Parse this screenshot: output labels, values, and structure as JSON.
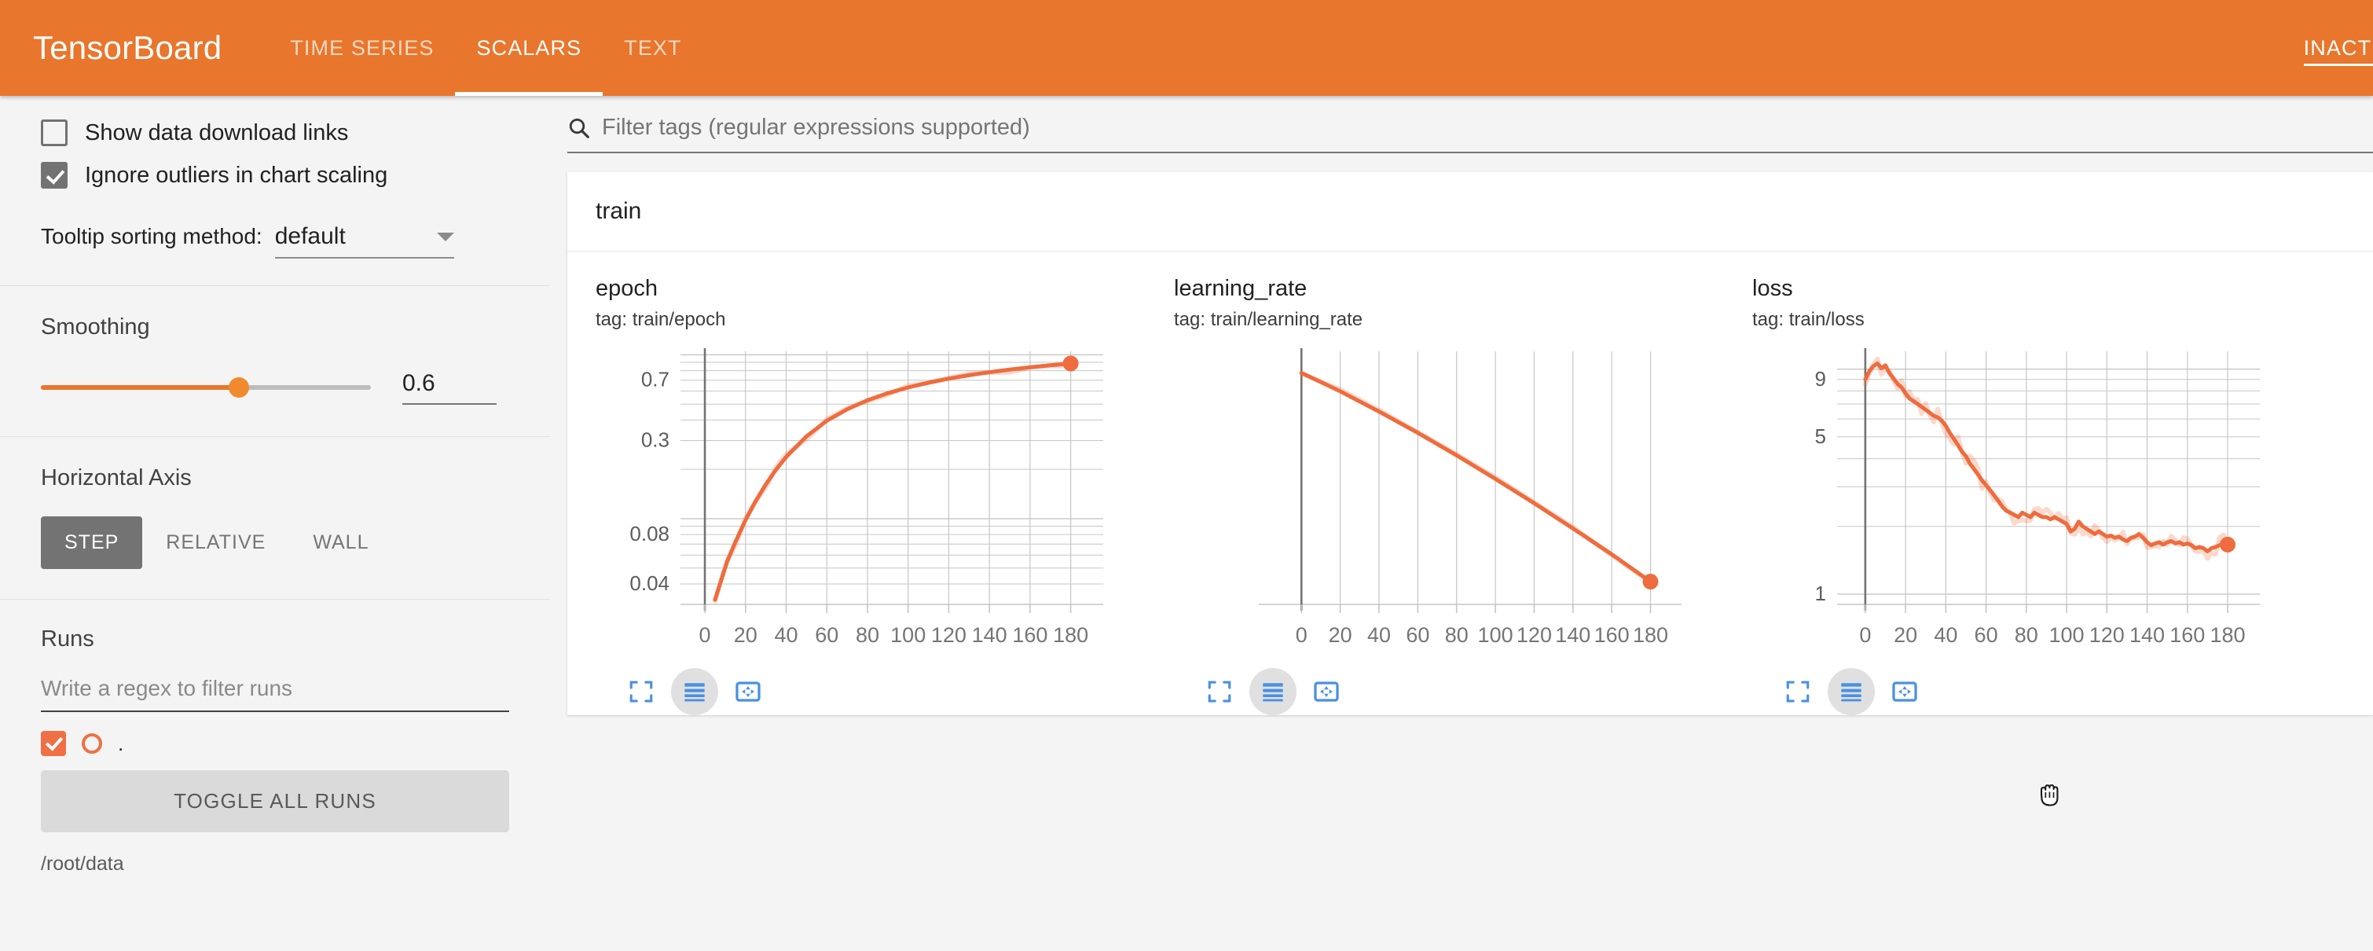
{
  "header": {
    "brand": "TensorBoard",
    "tabs": [
      {
        "label": "TIME SERIES",
        "active": false
      },
      {
        "label": "SCALARS",
        "active": true
      },
      {
        "label": "TEXT",
        "active": false
      }
    ],
    "right_tab": "INACTIVE",
    "accent_color": "#e8762c"
  },
  "sidebar": {
    "show_download_links": {
      "label": "Show data download links",
      "checked": false
    },
    "ignore_outliers": {
      "label": "Ignore outliers in chart scaling",
      "checked": true
    },
    "tooltip": {
      "label": "Tooltip sorting method:",
      "value": "default"
    },
    "smoothing": {
      "title": "Smoothing",
      "value": "0.6",
      "percent": 60
    },
    "horizontal_axis": {
      "title": "Horizontal Axis",
      "options": [
        {
          "label": "STEP",
          "active": true
        },
        {
          "label": "RELATIVE",
          "active": false
        },
        {
          "label": "WALL",
          "active": false
        }
      ]
    },
    "runs": {
      "title": "Runs",
      "filter_placeholder": "Write a regex to filter runs",
      "items": [
        {
          "name": ".",
          "checked": true,
          "color": "#ee7044"
        }
      ],
      "toggle_all_label": "TOGGLE ALL RUNS",
      "logdir": "/root/data"
    }
  },
  "main": {
    "search": {
      "placeholder": "Filter tags (regular expressions supported)"
    },
    "card_title": "train"
  },
  "chart_data": [
    {
      "type": "line",
      "title": "epoch",
      "tag": "tag: train/epoch",
      "xlabel": "",
      "ylabel": "",
      "xlim": [
        -12,
        196
      ],
      "ylim_log": [
        0.03,
        1.05
      ],
      "yscale": "log",
      "xticks": [
        0,
        20,
        40,
        60,
        80,
        100,
        120,
        140,
        160,
        180
      ],
      "yticks": [
        0.04,
        0.08,
        0.3,
        0.7
      ],
      "ytick_labels": [
        "0.04",
        "0.08",
        "0.3",
        "0.7"
      ],
      "grid": true,
      "series_color": "#ee6c3e",
      "x": [
        5,
        8,
        11,
        15,
        20,
        25,
        30,
        35,
        40,
        50,
        60,
        70,
        80,
        90,
        100,
        110,
        120,
        130,
        140,
        150,
        160,
        170,
        180
      ],
      "values": [
        0.032,
        0.042,
        0.055,
        0.072,
        0.098,
        0.128,
        0.162,
        0.199,
        0.238,
        0.318,
        0.396,
        0.465,
        0.528,
        0.583,
        0.632,
        0.676,
        0.715,
        0.751,
        0.783,
        0.812,
        0.839,
        0.863,
        0.885
      ],
      "end_marker": {
        "x": 180,
        "y": 0.885
      }
    },
    {
      "type": "line",
      "title": "learning_rate",
      "tag": "tag: train/learning_rate",
      "xlabel": "",
      "ylabel": "",
      "xlim": [
        -22,
        196
      ],
      "ylim": [
        0,
        1
      ],
      "yscale": "linear",
      "xticks": [
        0,
        20,
        40,
        60,
        80,
        100,
        120,
        140,
        160,
        180
      ],
      "yticks": [],
      "ytick_labels": [],
      "grid": true,
      "series_color": "#ee6c3e",
      "x": [
        0,
        20,
        40,
        60,
        80,
        100,
        120,
        140,
        160,
        180
      ],
      "values": [
        0.915,
        0.842,
        0.762,
        0.678,
        0.589,
        0.496,
        0.4,
        0.3,
        0.198,
        0.09
      ],
      "end_marker": {
        "x": 180,
        "y": 0.09
      }
    },
    {
      "type": "line",
      "title": "loss",
      "tag": "tag: train/loss",
      "xlabel": "",
      "ylabel": "",
      "xlim": [
        -14,
        196
      ],
      "ylim_log": [
        0.9,
        12
      ],
      "yscale": "log",
      "xticks": [
        0,
        20,
        40,
        60,
        80,
        100,
        120,
        140,
        160,
        180
      ],
      "yticks": [
        1,
        5,
        9
      ],
      "ytick_labels": [
        "1",
        "5",
        "9"
      ],
      "grid": true,
      "series_color": "#ee6c3e",
      "x": [
        0,
        2,
        4,
        6,
        8,
        10,
        12,
        14,
        16,
        18,
        20,
        22,
        24,
        26,
        28,
        30,
        32,
        34,
        36,
        38,
        40,
        42,
        44,
        46,
        48,
        50,
        52,
        54,
        56,
        58,
        60,
        62,
        64,
        66,
        68,
        70,
        72,
        74,
        76,
        78,
        80,
        82,
        84,
        86,
        88,
        90,
        92,
        94,
        96,
        98,
        100,
        102,
        104,
        106,
        108,
        110,
        112,
        114,
        116,
        118,
        120,
        122,
        124,
        126,
        128,
        130,
        132,
        134,
        136,
        138,
        140,
        142,
        144,
        146,
        148,
        150,
        152,
        154,
        156,
        158,
        160,
        162,
        164,
        166,
        168,
        170,
        172,
        174,
        176,
        178,
        180
      ],
      "values": [
        9.0,
        9.8,
        10.3,
        10.6,
        10.1,
        10.4,
        9.6,
        9.1,
        8.6,
        8.3,
        7.8,
        7.4,
        7.2,
        7.0,
        6.8,
        6.6,
        6.4,
        6.2,
        6.1,
        5.9,
        5.6,
        5.2,
        4.9,
        4.6,
        4.3,
        4.1,
        3.8,
        3.6,
        3.4,
        3.2,
        3.05,
        2.9,
        2.75,
        2.6,
        2.45,
        2.35,
        2.3,
        2.25,
        2.2,
        2.3,
        2.25,
        2.2,
        2.3,
        2.25,
        2.2,
        2.2,
        2.15,
        2.2,
        2.15,
        2.1,
        2.05,
        1.9,
        1.95,
        2.1,
        2.0,
        1.95,
        1.9,
        1.85,
        1.9,
        1.85,
        1.8,
        1.82,
        1.78,
        1.8,
        1.75,
        1.72,
        1.78,
        1.8,
        1.85,
        1.78,
        1.7,
        1.65,
        1.68,
        1.7,
        1.66,
        1.7,
        1.72,
        1.68,
        1.7,
        1.66,
        1.68,
        1.65,
        1.6,
        1.62,
        1.6,
        1.55,
        1.6,
        1.62,
        1.65,
        1.68,
        1.66
      ],
      "end_marker": {
        "x": 180,
        "y": 1.66
      }
    }
  ],
  "chart_toolbar": {
    "buttons": [
      {
        "icon": "fullscreen-icon",
        "active": false
      },
      {
        "icon": "data-lines-icon",
        "active": true
      },
      {
        "icon": "pan-icon",
        "active": false
      }
    ]
  }
}
